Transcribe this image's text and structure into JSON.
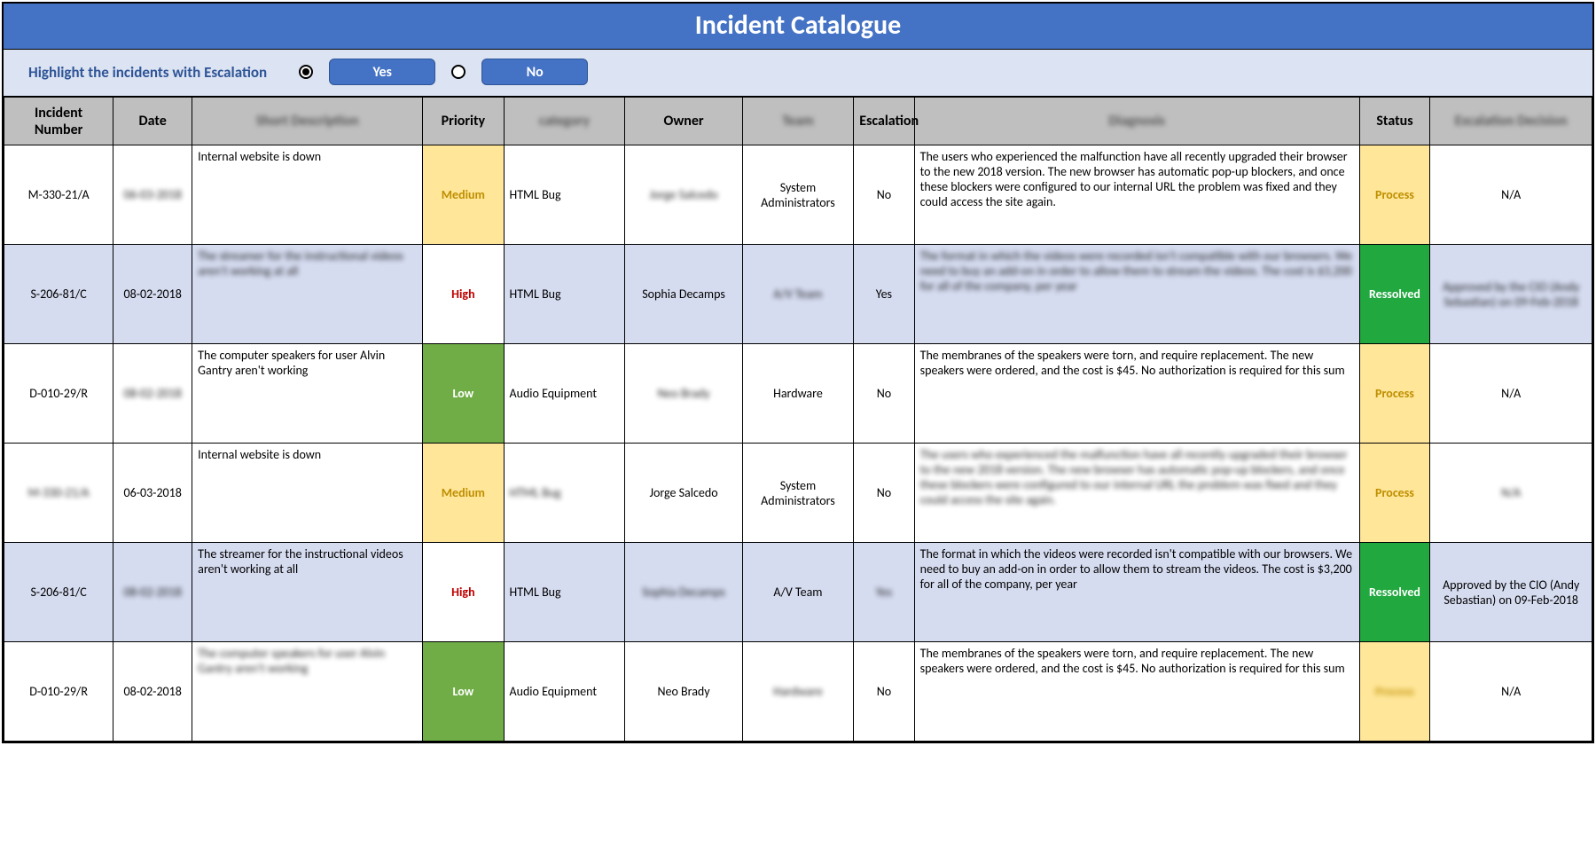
{
  "title": "Incident Catalogue",
  "filter": {
    "label": "Highlight the incidents with  Escalation",
    "yes": "Yes",
    "no": "No",
    "selected": "yes"
  },
  "columns": {
    "incident_number": "Incident Number",
    "date": "Date",
    "short_description": "Short Description",
    "priority": "Priority",
    "category": "category",
    "owner": "Owner",
    "team": "Team",
    "escalation": "Escalation",
    "diagnosis": "Diagnosis",
    "status": "Status",
    "escalation_decision": "Escalation Decision"
  },
  "rows": [
    {
      "incident_number": "M-330-21/A",
      "date": "06-03-2018",
      "short_description": "Internal website is down",
      "priority": "Medium",
      "category": "HTML Bug",
      "owner": "Jorge Salcedo",
      "team": "System Administrators",
      "escalation": "No",
      "diagnosis": "The users who experienced the malfunction have all recently upgraded their browser to the new 2018 version. The new browser has automatic pop-up blockers, and once these blockers were configured to our internal URL the problem was fixed and they could access the site again.",
      "status": "Process",
      "escalation_decision": "N/A",
      "blurred": [
        "date",
        "owner"
      ],
      "highlighted": false
    },
    {
      "incident_number": "S-206-81/C",
      "date": "08-02-2018",
      "short_description": "The streamer for the instructional videos aren't working at all",
      "priority": "High",
      "category": "HTML Bug",
      "owner": "Sophia Decamps",
      "team": "A/V Team",
      "escalation": "Yes",
      "diagnosis": "The format in which the videos were recorded isn't compatible with our browsers. We need to buy an add-on in order to allow them to stream the videos. The cost is $3,200 for all of the company, per year",
      "status": "Ressolved",
      "escalation_decision": "Approved by the CIO (Andy Sebastian) on 09-Feb-2018",
      "blurred": [
        "short_description",
        "team",
        "diagnosis",
        "escalation_decision"
      ],
      "highlighted": true
    },
    {
      "incident_number": "D-010-29/R",
      "date": "08-02-2018",
      "short_description": "The computer speakers for user Alvin Gantry aren't working",
      "priority": "Low",
      "category": "Audio Equipment",
      "owner": "Neo Brady",
      "team": "Hardware",
      "escalation": "No",
      "diagnosis": "The membranes of the speakers were torn, and require replacement. The new speakers were ordered, and the cost is $45. No authorization is required for this sum",
      "status": "Process",
      "escalation_decision": "N/A",
      "blurred": [
        "date",
        "owner"
      ],
      "highlighted": false
    },
    {
      "incident_number": "M-330-21/A",
      "date": "06-03-2018",
      "short_description": "Internal website is down",
      "priority": "Medium",
      "category": "HTML Bug",
      "owner": "Jorge Salcedo",
      "team": "System Administrators",
      "escalation": "No",
      "diagnosis": "The users who experienced the malfunction have all recently upgraded their browser to the new 2018 version. The new browser has automatic pop-up blockers, and once these blockers were configured to our internal URL the problem was fixed and they could access the site again.",
      "status": "Process",
      "escalation_decision": "N/A",
      "blurred": [
        "incident_number",
        "category",
        "diagnosis",
        "escalation_decision"
      ],
      "highlighted": false
    },
    {
      "incident_number": "S-206-81/C",
      "date": "08-02-2018",
      "short_description": "The streamer for the instructional videos aren't working at all",
      "priority": "High",
      "category": "HTML Bug",
      "owner": "Sophia Decamps",
      "team": "A/V Team",
      "escalation": "Yes",
      "diagnosis": "The format in which the videos were recorded isn't compatible with our browsers. We need to buy an add-on in order to allow them to stream the videos. The cost is $3,200 for all of the company, per year",
      "status": "Ressolved",
      "escalation_decision": "Approved by the CIO (Andy Sebastian) on 09-Feb-2018",
      "blurred": [
        "date",
        "owner",
        "escalation"
      ],
      "highlighted": true
    },
    {
      "incident_number": "D-010-29/R",
      "date": "08-02-2018",
      "short_description": "The computer speakers for user Alvin Gantry aren't working",
      "priority": "Low",
      "category": "Audio Equipment",
      "owner": "Neo Brady",
      "team": "Hardware",
      "escalation": "No",
      "diagnosis": "The membranes of the speakers were torn, and require replacement. The new speakers were ordered, and the cost is $45. No authorization is required for this sum",
      "status": "Process",
      "escalation_decision": "N/A",
      "blurred": [
        "short_description",
        "team",
        "status"
      ],
      "highlighted": false
    }
  ],
  "styles": {
    "priority": {
      "Medium": "prio-medium",
      "High": "prio-high",
      "Low": "prio-low"
    },
    "status": {
      "Process": "status-process",
      "Ressolved": "status-resolved"
    }
  },
  "header_blurred": [
    "short_description",
    "category",
    "team",
    "diagnosis",
    "escalation_decision"
  ]
}
